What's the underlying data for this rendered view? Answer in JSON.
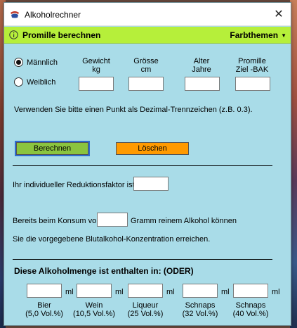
{
  "window": {
    "title": "Alkoholrechner"
  },
  "toolbar": {
    "title": "Promille berechnen",
    "menu": "Farbthemen"
  },
  "gender": {
    "male": "Männlich",
    "female": "Weiblich"
  },
  "columns": {
    "weight": [
      "Gewicht",
      "kg"
    ],
    "height": [
      "Grösse",
      "cm"
    ],
    "age": [
      "Alter",
      "Jahre"
    ],
    "promille": [
      "Promille",
      "Ziel -BAK"
    ]
  },
  "hint": "Verwenden Sie bitte einen Punkt als Dezimal-Trennzeichen (z.B. 0.3).",
  "buttons": {
    "calculate": "Berechnen",
    "clear": "Löschen"
  },
  "reduction_label": "Ihr individueller Reduktionsfaktor ist",
  "consumption": {
    "prefix": "Bereits beim Konsum von",
    "suffix": "Gramm reinem Alkohol können",
    "line2": "Sie die vorgegebene Blutalkohol-Konzentration erreichen."
  },
  "drinks_heading": "Diese Alkoholmenge ist enthalten in: (ODER)",
  "unit_ml": "ml",
  "drinks": [
    {
      "name": "Bier",
      "abv": "(5,0 Vol.%)"
    },
    {
      "name": "Wein",
      "abv": "(10,5 Vol.%)"
    },
    {
      "name": "Liqueur",
      "abv": "(25 Vol.%)"
    },
    {
      "name": "Schnaps",
      "abv": "(32 Vol.%)"
    },
    {
      "name": "Schnaps",
      "abv": "(40 Vol.%)"
    }
  ],
  "colors": {
    "background": "#a9dce8",
    "toolbar": "#b6ef3a",
    "calculate": "#8bc43f",
    "clear": "#ff9a00"
  }
}
